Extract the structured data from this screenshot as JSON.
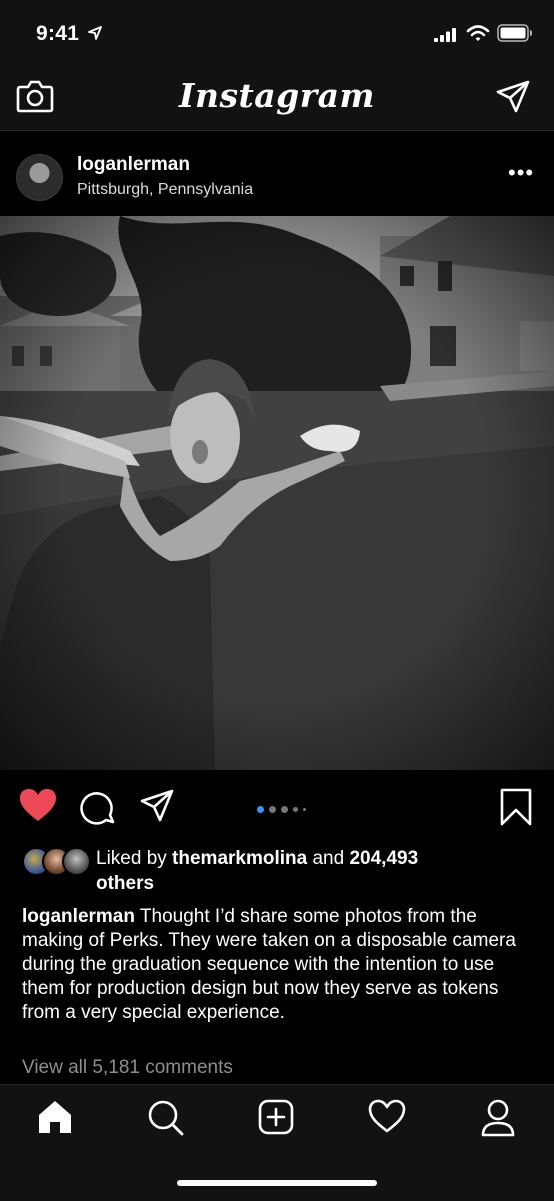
{
  "status_bar": {
    "time": "9:41"
  },
  "header": {
    "logo": "Instagram"
  },
  "post": {
    "username": "loganlerman",
    "location": "Pittsburgh, Pennsylvania",
    "more_label": "•••",
    "liked_by_prefix": "Liked by ",
    "liked_by_user": "themarkmolina",
    "liked_by_and": " and ",
    "liked_by_count": "204,493",
    "liked_by_suffix": "others",
    "caption_username": "loganlerman",
    "caption_text": " Thought I’d share some photos from the making of Perks. They were taken on a disposable camera during the graduation sequence with the intention to use them for production design but now they serve as tokens from a very special experience.",
    "view_comments": "View all 5,181 comments",
    "carousel_index": 1,
    "carousel_count": 5
  },
  "icons": [
    "camera-icon",
    "direct-send-icon",
    "heart-filled-icon",
    "comment-icon",
    "share-icon",
    "bookmark-icon",
    "home-icon",
    "search-icon",
    "new-post-icon",
    "activity-heart-icon",
    "profile-icon"
  ],
  "colors": {
    "like": "#ed4956",
    "carousel_active": "#3897f0",
    "background": "#000000",
    "bar": "#121212"
  }
}
